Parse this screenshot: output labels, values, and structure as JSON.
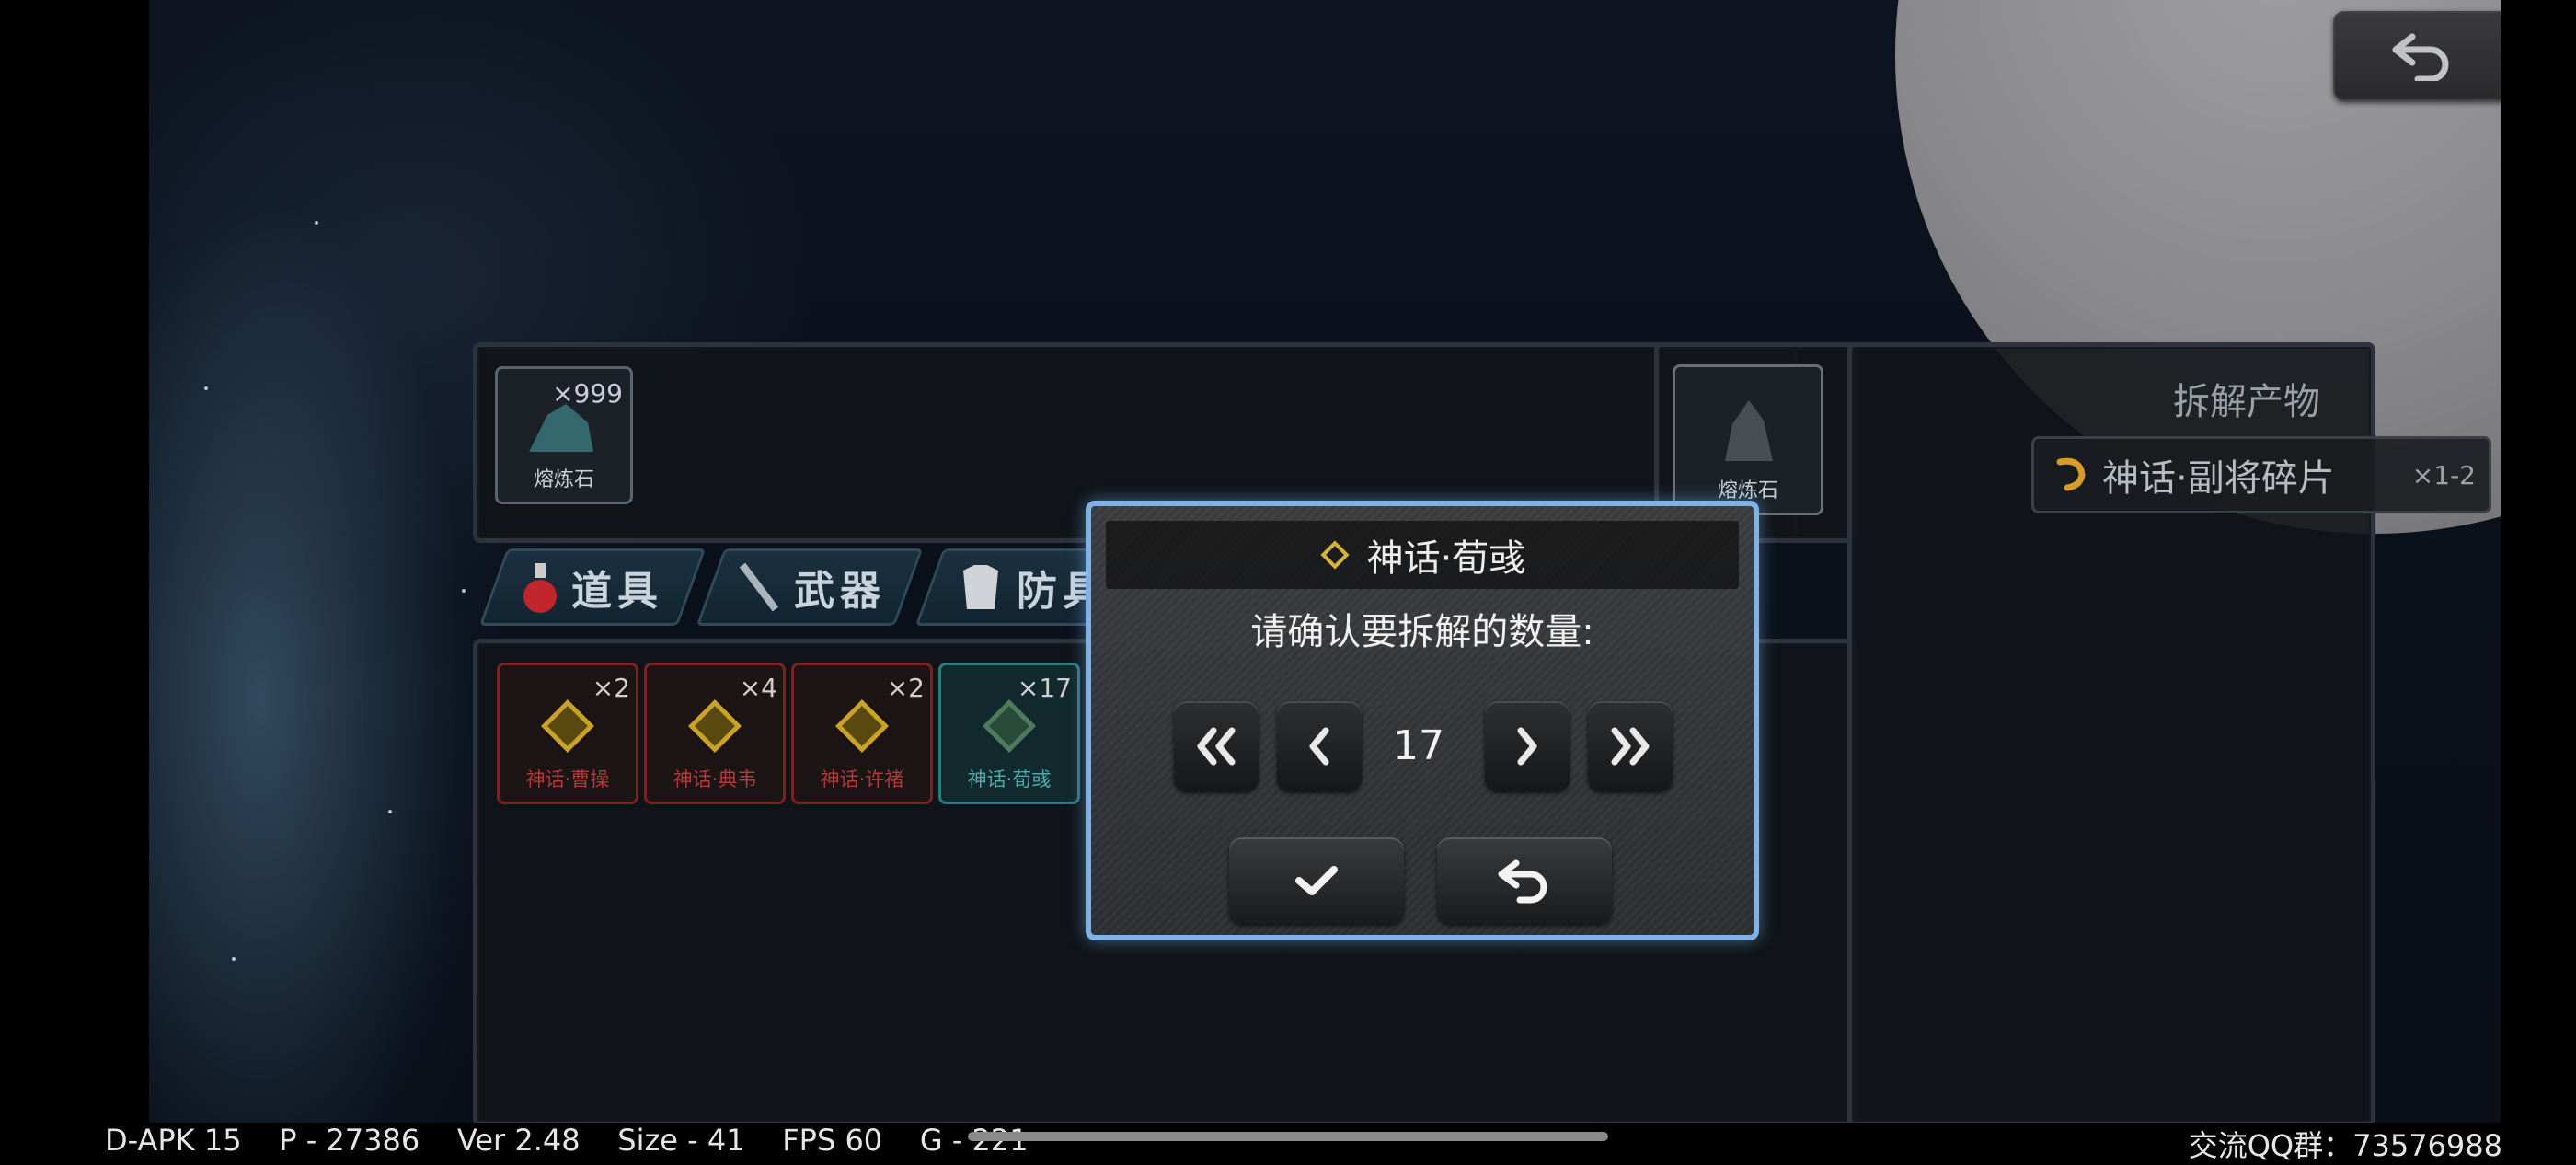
{
  "top": {
    "back_icon": "return-arrow-icon"
  },
  "material": {
    "name": "熔炼石",
    "count": "×999"
  },
  "material_target": {
    "name": "熔炼石"
  },
  "tabs": [
    {
      "label": "道具",
      "icon": "potion-icon"
    },
    {
      "label": "武器",
      "icon": "sword-icon"
    },
    {
      "label": "防具",
      "icon": "armor-icon"
    }
  ],
  "items": [
    {
      "name": "神话·曹操",
      "count": "×2"
    },
    {
      "name": "神话·典韦",
      "count": "×4"
    },
    {
      "name": "神话·许褚",
      "count": "×2"
    },
    {
      "name": "神话·荀彧",
      "count": "×17"
    }
  ],
  "output": {
    "title": "拆解产物",
    "item_name": "神话·副将碎片",
    "item_count": "×1-2"
  },
  "dialog": {
    "title": "神话·荀彧",
    "prompt": "请确认要拆解的数量:",
    "quantity": "17",
    "confirm_icon": "checkmark-icon",
    "cancel_icon": "return-arrow-icon"
  },
  "status": {
    "debug": "D-APK 15    P - 27386    Ver 2.48    Size - 41    FPS 60    G - 221",
    "qq": "交流QQ群：73576988"
  },
  "colors": {
    "dialog_border": "#7fb2e6",
    "item_border_red": "#7d2222",
    "item_border_selected": "#2a7c7e",
    "gold": "#c9a227"
  }
}
